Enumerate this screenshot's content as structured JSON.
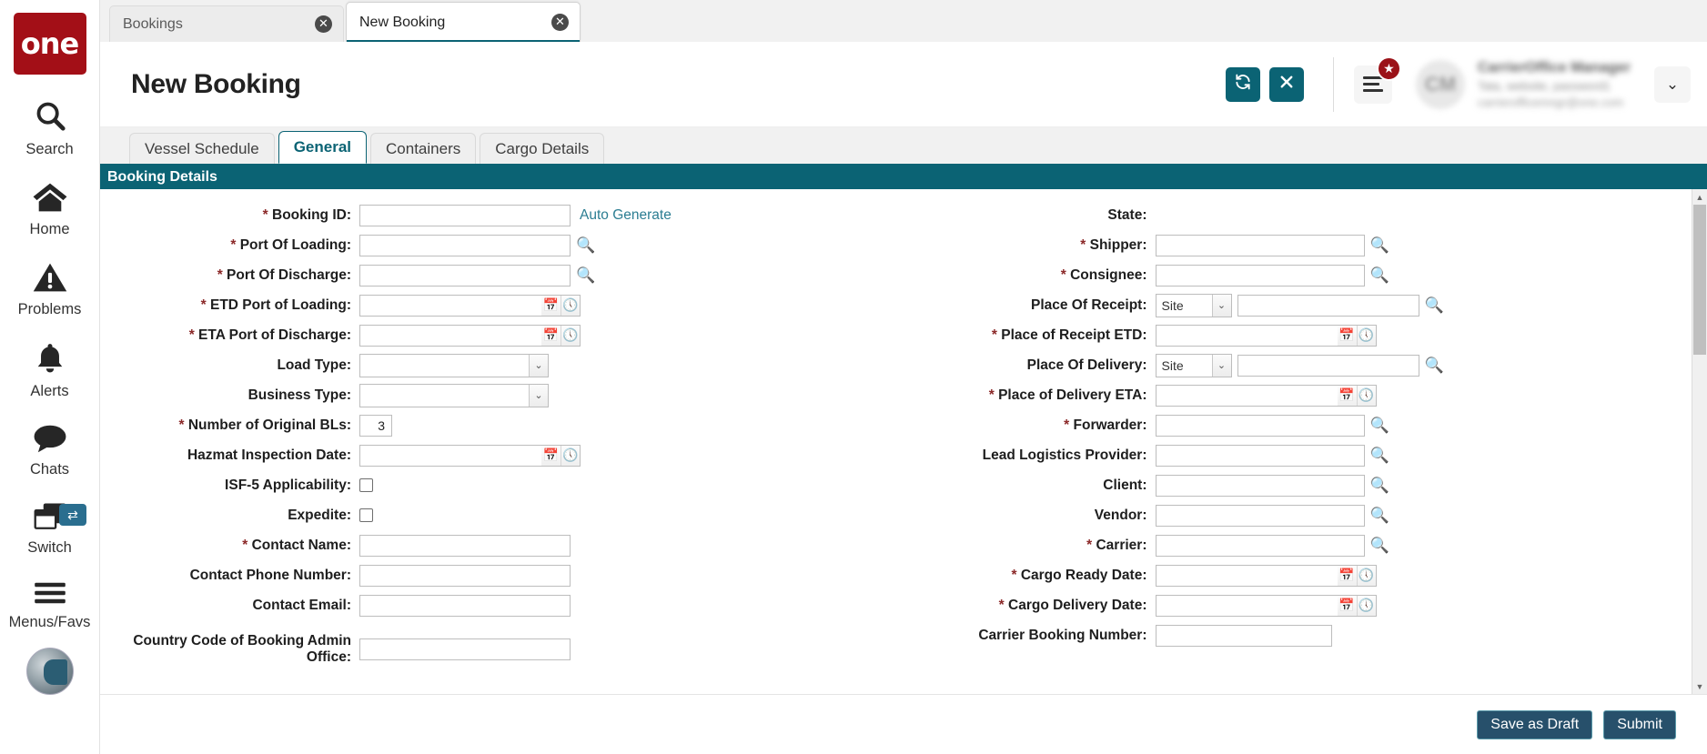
{
  "rail": {
    "logo_text": "one",
    "items": [
      {
        "label": "Search",
        "icon": "search-icon"
      },
      {
        "label": "Home",
        "icon": "home-icon"
      },
      {
        "label": "Problems",
        "icon": "warning-triangle-icon"
      },
      {
        "label": "Alerts",
        "icon": "bell-icon"
      },
      {
        "label": "Chats",
        "icon": "chat-bubble-icon"
      },
      {
        "label": "Switch",
        "icon": "windows-stack-icon",
        "badge_icon": "swap-arrows-icon"
      },
      {
        "label": "Menus/Favs",
        "icon": "hamburger-icon"
      }
    ]
  },
  "browser_tabs": [
    {
      "title": "Bookings",
      "active": false,
      "close_icon": "close-circle-icon"
    },
    {
      "title": "New Booking",
      "active": true,
      "close_icon": "close-circle-icon"
    }
  ],
  "header": {
    "title": "New Booking",
    "refresh_icon": "refresh-icon",
    "close_icon": "close-x-icon",
    "menu_icon": "hamburger-menu-icon",
    "favorite_badge_icon": "star-icon",
    "avatar_initials": "CM",
    "profile_name": "CarrierOffice Manager",
    "profile_role": "Tata, website, password1",
    "profile_email": "carrierofficemngr@one.com",
    "caret_icon": "chevron-down-icon"
  },
  "form_tabs": [
    {
      "label": "Vessel Schedule",
      "active": false
    },
    {
      "label": "General",
      "active": true
    },
    {
      "label": "Containers",
      "active": false
    },
    {
      "label": "Cargo Details",
      "active": false
    }
  ],
  "section": {
    "title": "Booking Details"
  },
  "left_fields": [
    {
      "label": "Booking ID",
      "required": true,
      "type": "text-autogen",
      "value": "",
      "link": "Auto Generate"
    },
    {
      "label": "Port Of Loading",
      "required": true,
      "type": "text-lookup",
      "value": ""
    },
    {
      "label": "Port Of Discharge",
      "required": true,
      "type": "text-lookup",
      "value": ""
    },
    {
      "label": "ETD Port of Loading",
      "required": true,
      "type": "datetime",
      "value": ""
    },
    {
      "label": "ETA Port of Discharge",
      "required": true,
      "type": "datetime",
      "value": ""
    },
    {
      "label": "Load Type",
      "required": false,
      "type": "select",
      "value": ""
    },
    {
      "label": "Business Type",
      "required": false,
      "type": "select",
      "value": ""
    },
    {
      "label": "Number of Original BLs",
      "required": true,
      "type": "number",
      "value": "3"
    },
    {
      "label": "Hazmat Inspection Date",
      "required": false,
      "type": "datetime",
      "value": ""
    },
    {
      "label": "ISF-5 Applicability",
      "required": false,
      "type": "checkbox",
      "checked": false
    },
    {
      "label": "Expedite",
      "required": false,
      "type": "checkbox",
      "checked": false
    },
    {
      "label": "Contact Name",
      "required": true,
      "type": "text",
      "value": ""
    },
    {
      "label": "Contact Phone Number",
      "required": false,
      "type": "text",
      "value": ""
    },
    {
      "label": "Contact Email",
      "required": false,
      "type": "text",
      "value": ""
    },
    {
      "label": "Country Code of Booking Admin Office",
      "required": false,
      "type": "text",
      "value": "",
      "two_line": true
    }
  ],
  "right_fields": [
    {
      "label": "State",
      "required": false,
      "type": "readonly",
      "value": ""
    },
    {
      "label": "Shipper",
      "required": true,
      "type": "text-lookup",
      "value": ""
    },
    {
      "label": "Consignee",
      "required": true,
      "type": "text-lookup",
      "value": ""
    },
    {
      "label": "Place Of Receipt",
      "required": false,
      "type": "select-lookup",
      "value": "",
      "select_value": "Site"
    },
    {
      "label": "Place of Receipt ETD",
      "required": true,
      "type": "datetime",
      "value": ""
    },
    {
      "label": "Place Of Delivery",
      "required": false,
      "type": "select-lookup",
      "value": "",
      "select_value": "Site"
    },
    {
      "label": "Place of Delivery ETA",
      "required": true,
      "type": "datetime",
      "value": ""
    },
    {
      "label": "Forwarder",
      "required": true,
      "type": "text-lookup",
      "value": ""
    },
    {
      "label": "Lead Logistics Provider",
      "required": false,
      "type": "text-lookup",
      "value": ""
    },
    {
      "label": "Client",
      "required": false,
      "type": "text-lookup",
      "value": ""
    },
    {
      "label": "Vendor",
      "required": false,
      "type": "text-lookup",
      "value": ""
    },
    {
      "label": "Carrier",
      "required": true,
      "type": "text-lookup",
      "value": ""
    },
    {
      "label": "Cargo Ready Date",
      "required": true,
      "type": "datetime",
      "value": ""
    },
    {
      "label": "Cargo Delivery Date",
      "required": true,
      "type": "datetime",
      "value": ""
    },
    {
      "label": "Carrier Booking Number",
      "required": false,
      "type": "text-narrow",
      "value": ""
    }
  ],
  "footer": {
    "save_draft_label": "Save as Draft",
    "submit_label": "Submit"
  },
  "scrollbar": {
    "up_icon": "triangle-up-icon",
    "down_icon": "triangle-down-icon"
  },
  "colors": {
    "brand_red": "#a30f17",
    "teal": "#0b6374",
    "button_navy": "#27506b",
    "link_teal": "#2b7d92",
    "required_red": "#8c2a2a"
  }
}
